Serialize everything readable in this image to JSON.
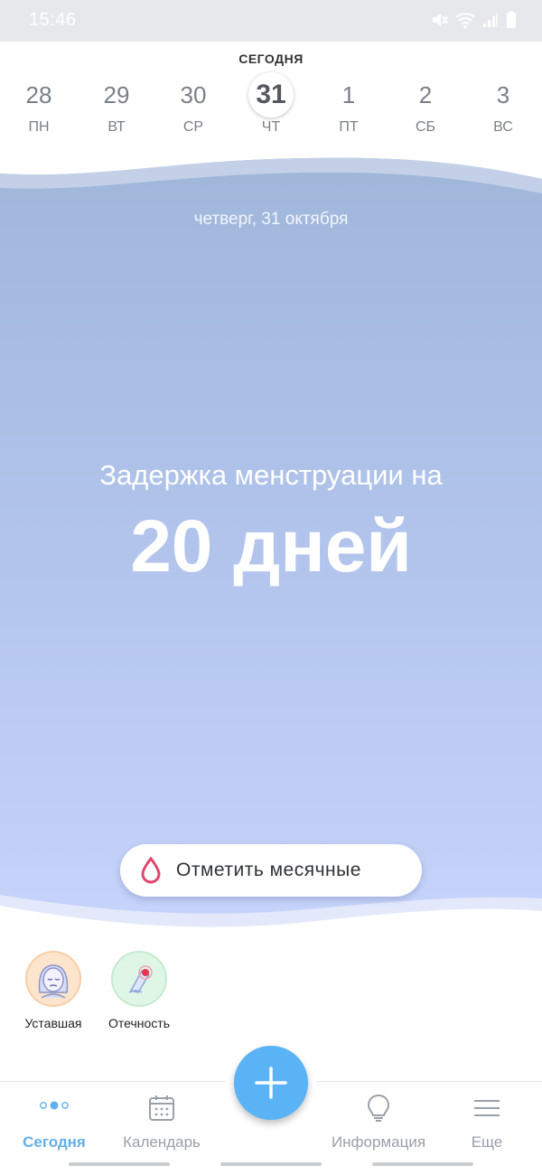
{
  "status_bar": {
    "time": "15:46"
  },
  "week": {
    "today_caption": "СЕГОДНЯ",
    "days": [
      {
        "num": "28",
        "name": "ПН"
      },
      {
        "num": "29",
        "name": "ВТ"
      },
      {
        "num": "30",
        "name": "СР"
      },
      {
        "num": "31",
        "name": "ЧТ"
      },
      {
        "num": "1",
        "name": "ПТ"
      },
      {
        "num": "2",
        "name": "СБ"
      },
      {
        "num": "3",
        "name": "ВС"
      }
    ]
  },
  "hero": {
    "date_line": "четверг, 31 октября",
    "delay_text": "Задержка менструации на",
    "delay_value": "20 дней",
    "mark_button_label": "Отметить месячные"
  },
  "symptoms": [
    {
      "label": "Уставшая",
      "icon": "tired-face-icon"
    },
    {
      "label": "Отечность",
      "icon": "swelling-icon"
    }
  ],
  "nav": {
    "items": [
      {
        "label": "Сегодня",
        "icon": "today-dots-icon"
      },
      {
        "label": "Календарь",
        "icon": "calendar-icon"
      },
      {
        "label": "Информация",
        "icon": "lightbulb-icon"
      },
      {
        "label": "Еще",
        "icon": "menu-icon"
      }
    ],
    "add_icon": "plus-icon"
  },
  "colors": {
    "accent": "#5ab3f5",
    "drop": "#e0466e",
    "nav_active": "#62b0ea"
  }
}
